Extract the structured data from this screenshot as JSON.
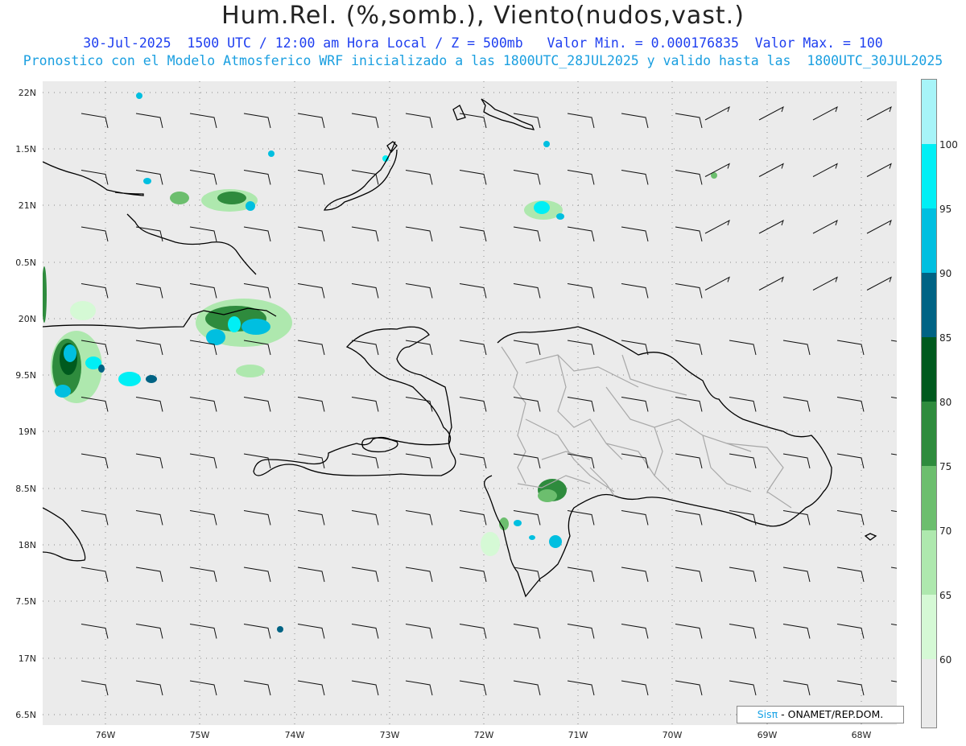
{
  "header": {
    "title": "Hum.Rel. (%,somb.), Viento(nudos,vast.)",
    "subtitle_1": "30-Jul-2025  1500 UTC / 12:00 am Hora Local / Z = 500mb   Valor Min. = 0.000176835  Valor Max. = 100",
    "subtitle_2": "Pronostico con el Modelo Atmosferico WRF inicializado a las 1800UTC_28JUL2025 y valido hasta las  1800UTC_30JUL2025"
  },
  "axes": {
    "lat_labels": [
      "22N",
      "1.5N",
      "21N",
      "0.5N",
      "20N",
      "9.5N",
      "19N",
      "8.5N",
      "18N",
      "7.5N",
      "17N",
      "6.5N"
    ],
    "lon_labels": [
      "76W",
      "75W",
      "74W",
      "73W",
      "72W",
      "71W",
      "70W",
      "69W",
      "68W"
    ]
  },
  "colorbar": {
    "labels": [
      "100",
      "95",
      "90",
      "85",
      "80",
      "75",
      "70",
      "65",
      "60"
    ],
    "colors": [
      "#a7f4f8",
      "#00eff5",
      "#00bfe0",
      "#006384",
      "#005a1e",
      "#2e8b3d",
      "#6cbe6e",
      "#aee8ae",
      "#d5f9d5",
      "#eaeaea"
    ]
  },
  "credit": {
    "logo": "Sisπ",
    "text": " - ONAMET/REP.DOM."
  },
  "map_style": {
    "background": "#ebebeb",
    "coast_color": "#000000",
    "province_color": "#a8a8a8",
    "grid_color": "#8a8a8a"
  }
}
